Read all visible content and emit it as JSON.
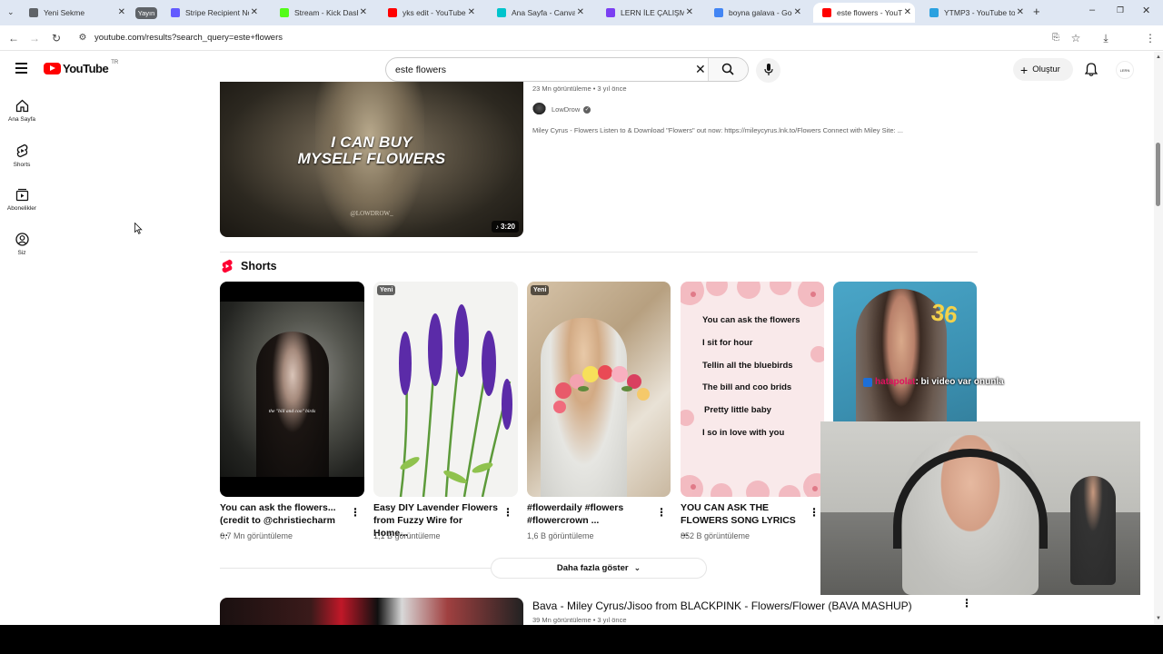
{
  "tabs": [
    {
      "label": "Yeni Sekme",
      "color": "#5f6368"
    },
    {
      "label": "Yayın",
      "color": "#5f6368",
      "pill": true
    },
    {
      "label": "Stripe Recipient Not",
      "color": "#635bff"
    },
    {
      "label": "Stream - Kick Dashb",
      "color": "#53fc18"
    },
    {
      "label": "yks edit - YouTube",
      "color": "#ff0000"
    },
    {
      "label": "Ana Sayfa - Canva",
      "color": "#00c4cc"
    },
    {
      "label": "LERN İLE ÇALIŞMAY",
      "color": "#7b3ff2"
    },
    {
      "label": "boyna galava - Goo",
      "color": "#4285f4"
    },
    {
      "label": "este flowers - YouTu",
      "color": "#ff0000"
    },
    {
      "label": "YTMP3 - YouTube to",
      "color": "#2aa1e0"
    }
  ],
  "address": "youtube.com/results?search_query=este+flowers",
  "header": {
    "logo_text": "YouTube",
    "region": "TR",
    "search_value": "este flowers",
    "create_label": "Oluştur"
  },
  "sidebar": {
    "items": [
      {
        "label": "Ana Sayfa",
        "icon": "home-icon"
      },
      {
        "label": "Shorts",
        "icon": "shorts-icon"
      },
      {
        "label": "Abonelikler",
        "icon": "subscriptions-icon"
      },
      {
        "label": "Siz",
        "icon": "you-icon"
      }
    ]
  },
  "top_video": {
    "meta": "23 Mn görüntüleme • 3 yıl önce",
    "channel": "LowDrow",
    "description": "Miley Cyrus - Flowers Listen to & Download \"Flowers\" out now: https://mileycyrus.lnk.to/Flowers Connect with Miley Site: ...",
    "thumb_text_1": "I CAN BUY",
    "thumb_text_2": "MYSELF FLOWERS",
    "watermark": "@LOWDROW_",
    "duration": "3:20"
  },
  "shorts": {
    "heading": "Shorts",
    "items": [
      {
        "title_1": "You can ask the flowers...",
        "title_2": "(credit to @christiecharm ...",
        "views": "6,7 Mn görüntüleme",
        "badge": "",
        "caption": "the \"bill and coo\" birds"
      },
      {
        "title_1": "Easy DIY Lavender Flowers",
        "title_2": "from Fuzzy Wire for Home...",
        "views": "1,1 B görüntüleme",
        "badge": "Yeni"
      },
      {
        "title_1": "#flowerdaily #flowers",
        "title_2": "#flowercrown ...",
        "views": "1,6 B görüntüleme",
        "badge": "Yeni"
      },
      {
        "title_1": "YOU CAN ASK THE",
        "title_2": "FLOWERS SONG LYRICS ...",
        "views": "852 B görüntüleme",
        "badge": ""
      }
    ],
    "lyrics": [
      "You can ask the flowers",
      "I sit for hour",
      "Tellin all the bluebirds",
      "The bill and coo brids",
      "Pretty little baby",
      "I so in love with you"
    ],
    "show_more": "Daha fazla göster"
  },
  "overlay_chat": {
    "user": "hatapolat",
    "message": ": bi video var onunla"
  },
  "next_video": {
    "title": "Bava - Miley Cyrus/Jisoo from BLACKPINK - Flowers/Flower (BAVA MASHUP)",
    "meta": "39 Mn görüntüleme • 3 yıl önce"
  }
}
